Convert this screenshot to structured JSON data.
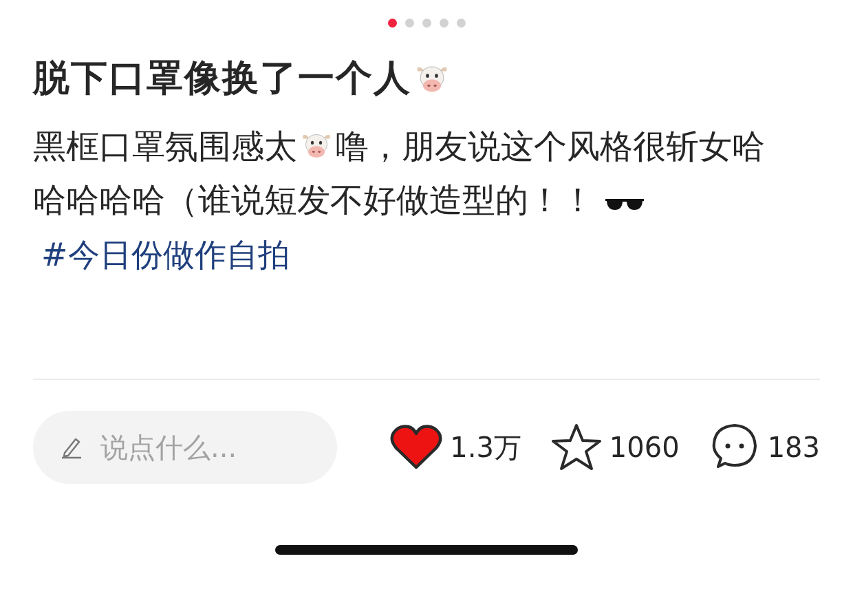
{
  "carousel_dots": [
    {
      "selected": true
    },
    {
      "selected": false
    },
    {
      "selected": false
    },
    {
      "selected": false
    },
    {
      "selected": false
    }
  ],
  "post": {
    "title": "脱下口罩像换了一个人",
    "body_lines": [
      {
        "before_icon": "黑框口罩氛围感太",
        "after_icon": "噜，朋友说这个风格很斩女哈"
      },
      {
        "text": "哈哈哈哈（谁说短发不好做造型的！！"
      }
    ],
    "hashtag": "#今日份做作自拍"
  },
  "action_bar": {
    "comment_field": {
      "placeholder": "说点什么..."
    },
    "like": {
      "count": "1.3万",
      "liked": true
    },
    "favorite": {
      "count": "1060",
      "favorited": false
    },
    "comments": {
      "count": "183"
    }
  }
}
